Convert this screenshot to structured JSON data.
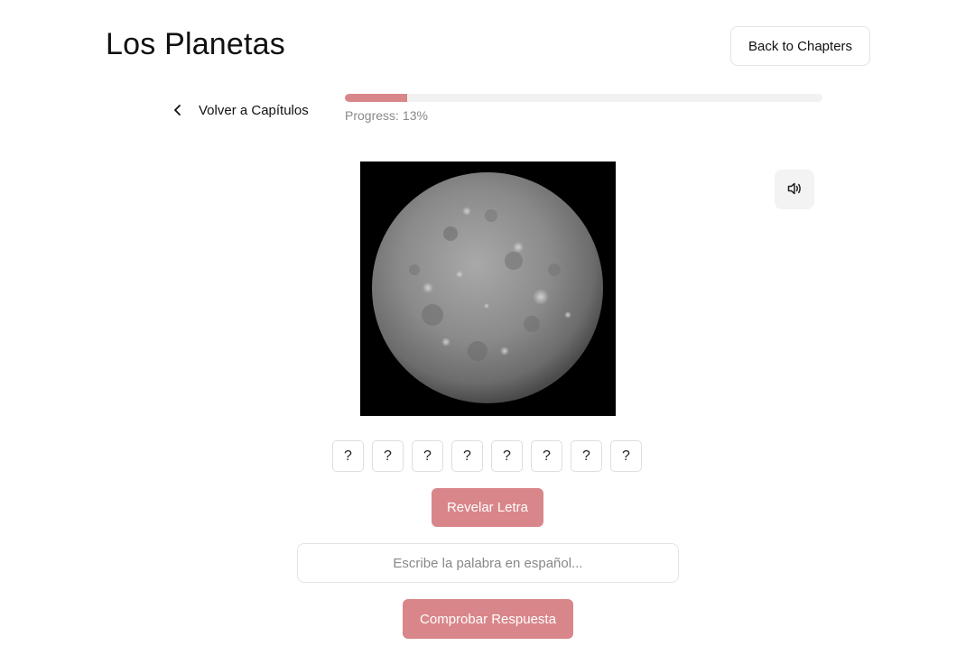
{
  "header": {
    "title": "Los Planetas",
    "back_button_label": "Back to Chapters"
  },
  "nav": {
    "volver_label": "Volver a Capítulos",
    "icon": "chevron-left-icon"
  },
  "progress": {
    "label": "Progress:",
    "value_text": "13%",
    "fraction": 0.13,
    "fill_color": "#d9868a",
    "track_color": "#f1f1f1"
  },
  "quiz": {
    "image_subject": "planet Mercury photograph",
    "sound_icon": "speaker-volume-icon",
    "letters": [
      "?",
      "?",
      "?",
      "?",
      "?",
      "?",
      "?",
      "?"
    ],
    "reveal_label": "Revelar Letra",
    "answer_placeholder": "Escribe la palabra en español...",
    "answer_value": "",
    "check_label": "Comprobar Respuesta"
  },
  "colors": {
    "accent": "#d9868a",
    "text": "#111111",
    "muted": "#888888"
  }
}
